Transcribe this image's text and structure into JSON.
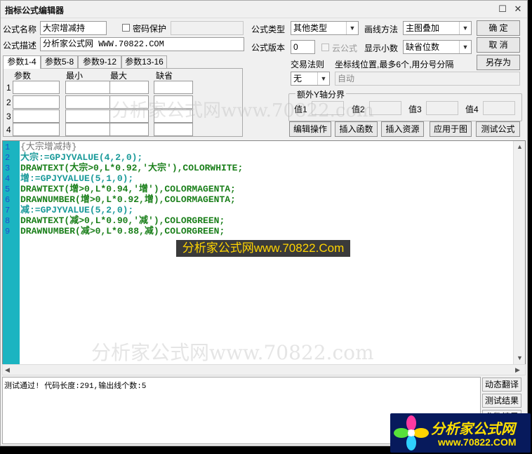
{
  "window": {
    "title": "指标公式编辑器"
  },
  "form": {
    "formula_name_label": "公式名称",
    "formula_name_value": "大宗增减持",
    "password_label": "密码保护",
    "description_label": "公式描述",
    "description_value": "分析家公式网 WWW.70822.COM",
    "formula_type_label": "公式类型",
    "formula_type_value": "其他类型",
    "draw_method_label": "画线方法",
    "draw_method_value": "主图叠加",
    "version_label": "公式版本",
    "version_value": "0",
    "cloud_label": "云公式",
    "decimal_label": "显示小数",
    "decimal_value": "缺省位数",
    "trade_rule_label": "交易法则",
    "trade_rule_value": "无",
    "coord_label": "坐标线位置,最多6个,用分号分隔",
    "coord_value": "自动",
    "yaxis_group_label": "额外Y轴分界",
    "val1_label": "值1",
    "val2_label": "值2",
    "val3_label": "值3",
    "val4_label": "值4"
  },
  "buttons": {
    "ok": "确  定",
    "cancel": "取  消",
    "save_as": "另存为",
    "edit_ops": "编辑操作",
    "insert_func": "插入函数",
    "insert_res": "插入资源",
    "apply_chart": "应用于图",
    "test_formula": "测试公式"
  },
  "tabs": [
    "参数1-4",
    "参数5-8",
    "参数9-12",
    "参数13-16"
  ],
  "params": {
    "headers": [
      "参数",
      "最小",
      "最大",
      "缺省"
    ],
    "rows": [
      "1",
      "2",
      "3",
      "4"
    ]
  },
  "code_lines": [
    "{大宗增减持}",
    "大宗:=GPJYVALUE(4,2,0);",
    "DRAWTEXT(大宗>0,L*0.92,'大宗'),COLORWHITE;",
    "增:=GPJYVALUE(5,1,0);",
    "DRAWTEXT(增>0,L*0.94,'增'),COLORMAGENTA;",
    "DRAWNUMBER(增>0,L*0.92,增),COLORMAGENTA;",
    "减:=GPJYVALUE(5,2,0);",
    "DRAWTEXT(减>0,L*0.90,'减'),COLORGREEN;",
    "DRAWNUMBER(减>0,L*0.88,减),COLORGREEN;"
  ],
  "output_text": "测试通过! 代码长度:291,输出线个数:5",
  "side_buttons": [
    "动态翻译",
    "测试结果",
    "参数精灵"
  ],
  "watermarks": {
    "top": "分析家公式网www.70822.com",
    "bottom": "分析家公式网www.70822.com",
    "popup": "分析家公式网www.70822.Com"
  },
  "logo": {
    "name": "分析家公式网",
    "url": "www.70822.COM"
  },
  "colors": {
    "gutter": "#1bb4c1",
    "popup_text": "#ffd400",
    "logo_bg": "#071a5c"
  }
}
